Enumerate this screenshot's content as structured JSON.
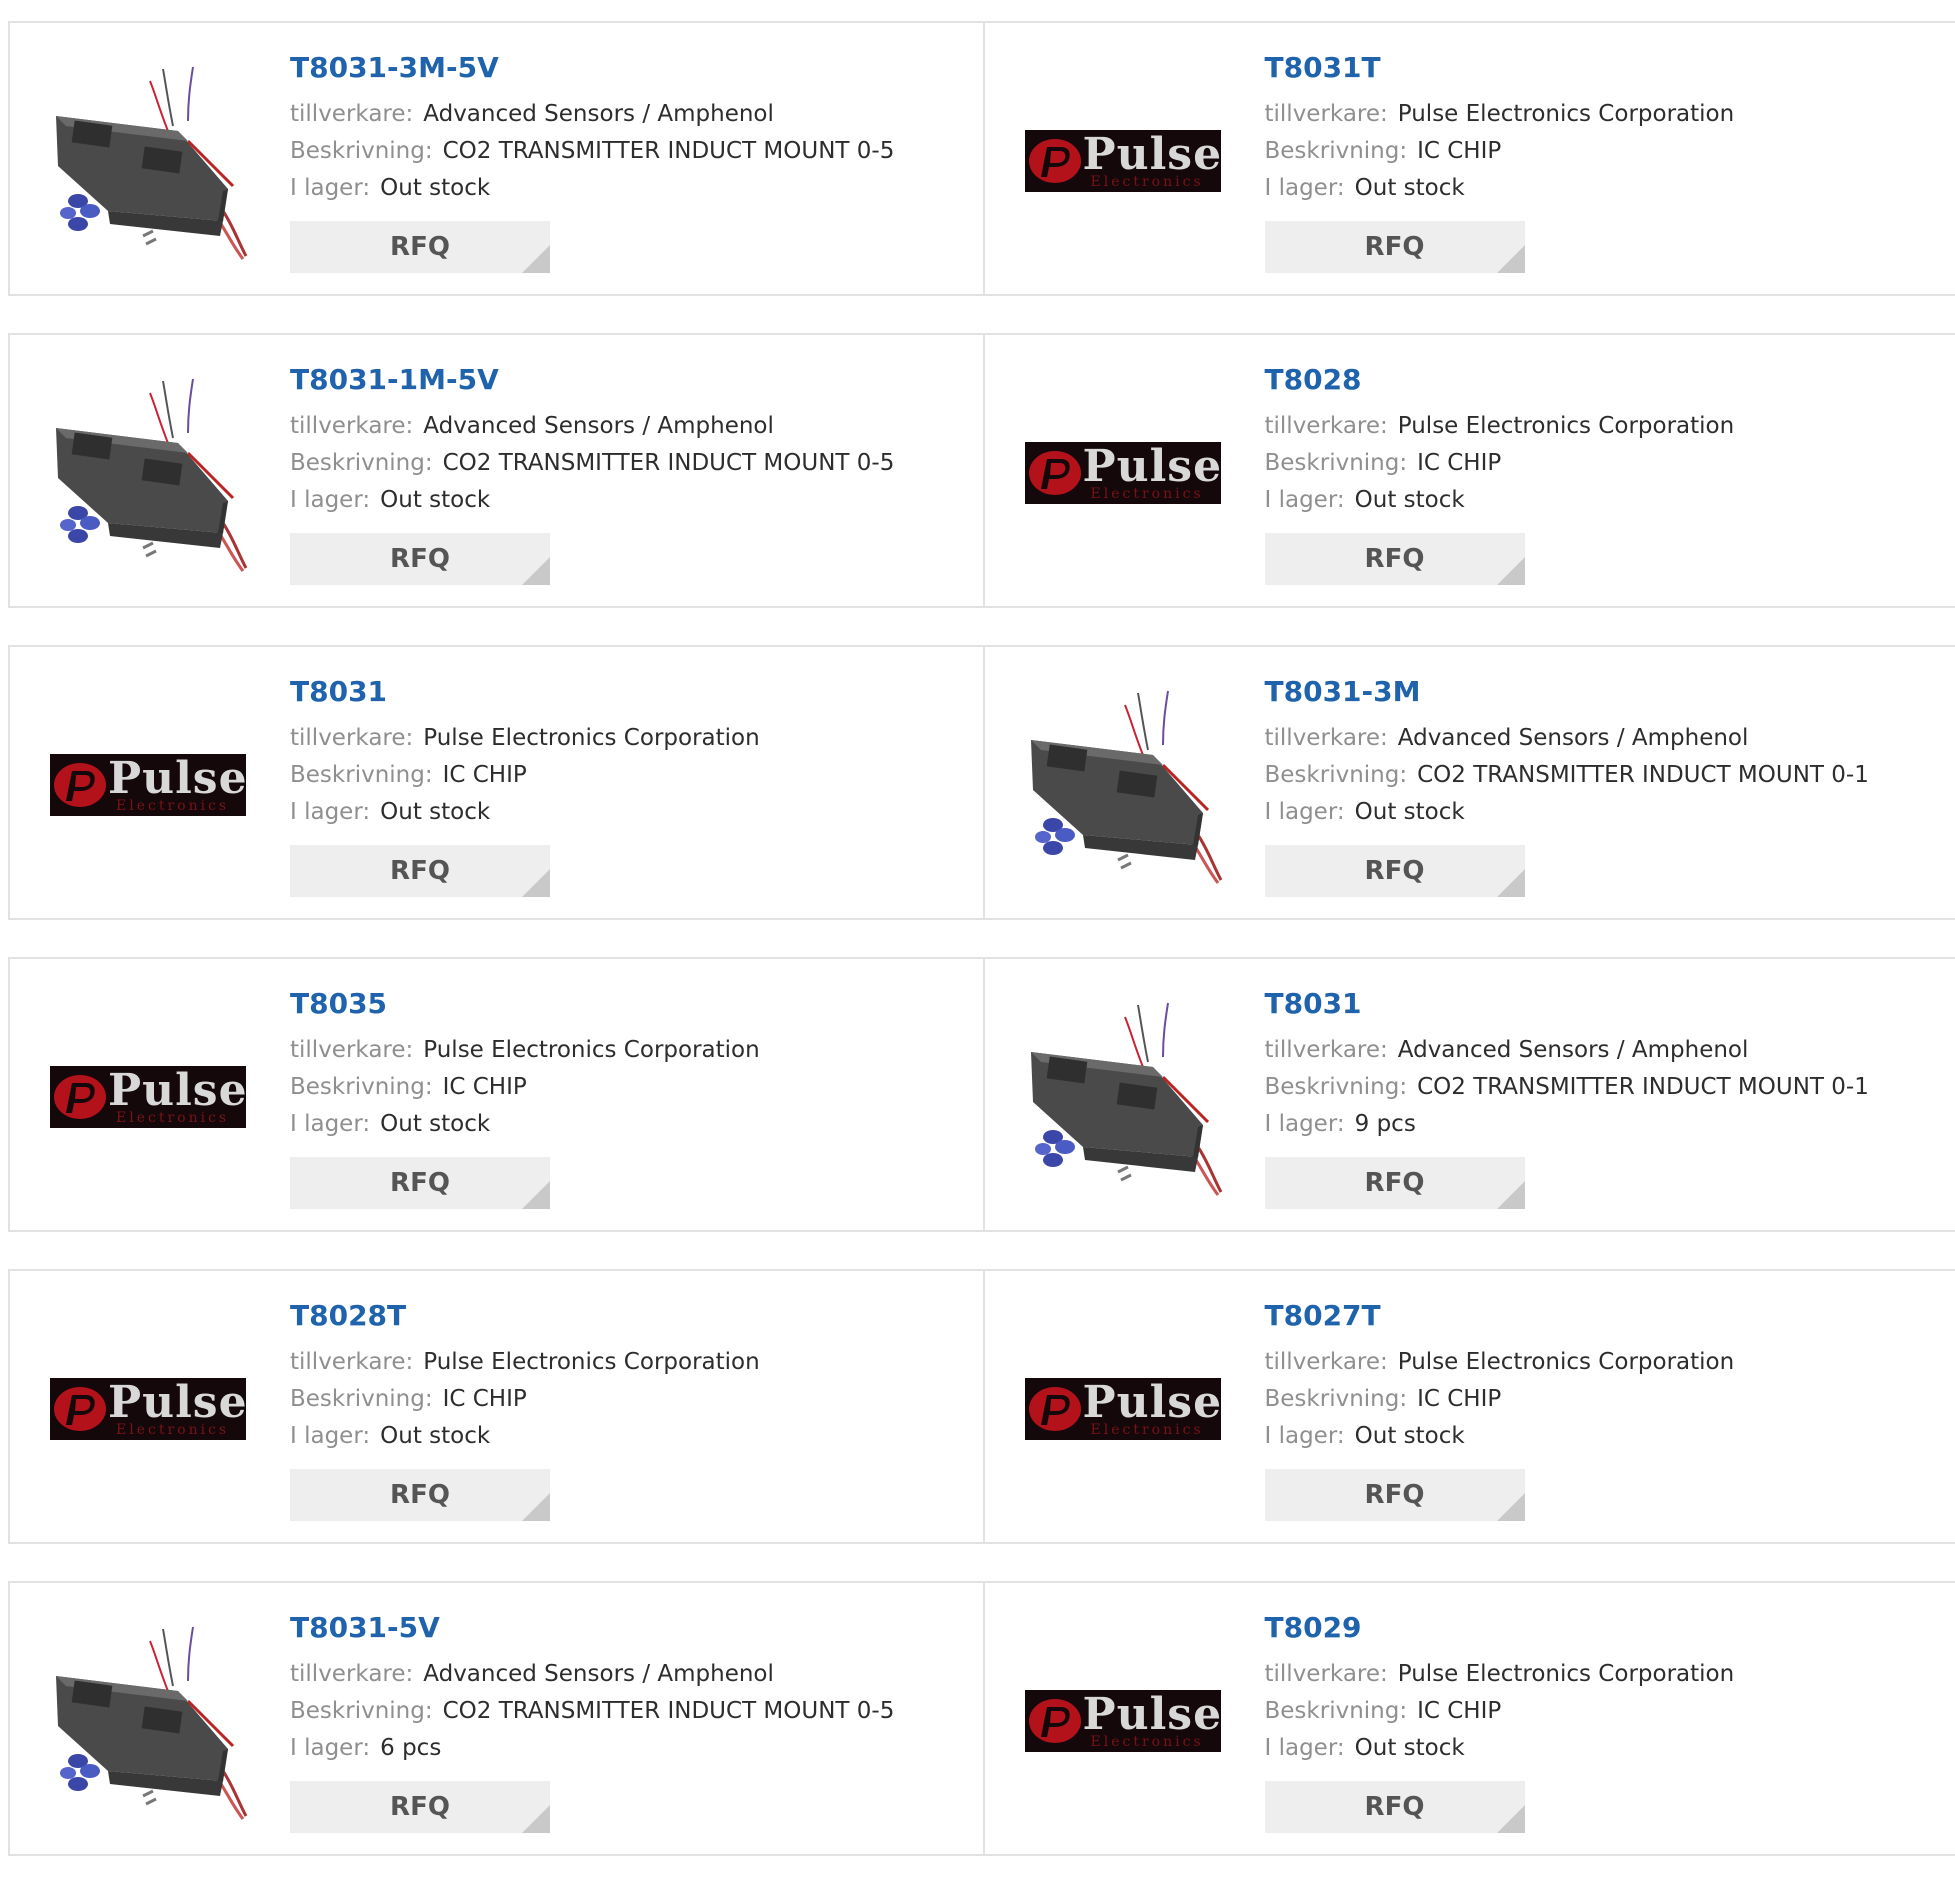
{
  "labels": {
    "manufacturer": "tillverkare:",
    "description": "Beskrivning:",
    "stock": "I lager:",
    "rfq": "RFQ"
  },
  "logo": {
    "brand": "Pulse",
    "sub": "Electronics"
  },
  "colors": {
    "title": "#1f63ad",
    "label": "#8f8f8f",
    "value": "#2d2d2d",
    "border": "#e2e2e2",
    "rfq_bg": "#eeeeee",
    "logo_bg": "#15080a",
    "logo_red": "#b3121a"
  },
  "products": [
    {
      "part": "T8031-3M-5V",
      "manufacturer": "Advanced Sensors / Amphenol",
      "description": "CO2 TRANSMITTER INDUCT MOUNT 0-5",
      "stock": "Out stock",
      "image": "sensor-device"
    },
    {
      "part": "T8031T",
      "manufacturer": "Pulse Electronics Corporation",
      "description": "IC CHIP",
      "stock": "Out stock",
      "image": "pulse-logo"
    },
    {
      "part": "T8031-1M-5V",
      "manufacturer": "Advanced Sensors / Amphenol",
      "description": "CO2 TRANSMITTER INDUCT MOUNT 0-5",
      "stock": "Out stock",
      "image": "sensor-device"
    },
    {
      "part": "T8028",
      "manufacturer": "Pulse Electronics Corporation",
      "description": "IC CHIP",
      "stock": "Out stock",
      "image": "pulse-logo"
    },
    {
      "part": "T8031",
      "manufacturer": "Pulse Electronics Corporation",
      "description": "IC CHIP",
      "stock": "Out stock",
      "image": "pulse-logo"
    },
    {
      "part": "T8031-3M",
      "manufacturer": "Advanced Sensors / Amphenol",
      "description": "CO2 TRANSMITTER INDUCT MOUNT 0-1",
      "stock": "Out stock",
      "image": "sensor-device"
    },
    {
      "part": "T8035",
      "manufacturer": "Pulse Electronics Corporation",
      "description": "IC CHIP",
      "stock": "Out stock",
      "image": "pulse-logo"
    },
    {
      "part": "T8031",
      "manufacturer": "Advanced Sensors / Amphenol",
      "description": "CO2 TRANSMITTER INDUCT MOUNT 0-1",
      "stock": "9 pcs",
      "image": "sensor-device"
    },
    {
      "part": "T8028T",
      "manufacturer": "Pulse Electronics Corporation",
      "description": "IC CHIP",
      "stock": "Out stock",
      "image": "pulse-logo"
    },
    {
      "part": "T8027T",
      "manufacturer": "Pulse Electronics Corporation",
      "description": "IC CHIP",
      "stock": "Out stock",
      "image": "pulse-logo"
    },
    {
      "part": "T8031-5V",
      "manufacturer": "Advanced Sensors / Amphenol",
      "description": "CO2 TRANSMITTER INDUCT MOUNT 0-5",
      "stock": "6 pcs",
      "image": "sensor-device"
    },
    {
      "part": "T8029",
      "manufacturer": "Pulse Electronics Corporation",
      "description": "IC CHIP",
      "stock": "Out stock",
      "image": "pulse-logo"
    }
  ]
}
